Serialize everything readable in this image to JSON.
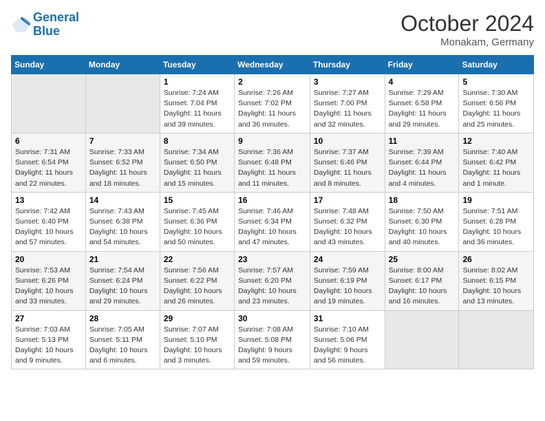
{
  "header": {
    "logo_line1": "General",
    "logo_line2": "Blue",
    "month": "October 2024",
    "location": "Monakam, Germany"
  },
  "columns": [
    "Sunday",
    "Monday",
    "Tuesday",
    "Wednesday",
    "Thursday",
    "Friday",
    "Saturday"
  ],
  "weeks": [
    [
      {
        "day": "",
        "info": ""
      },
      {
        "day": "",
        "info": ""
      },
      {
        "day": "1",
        "info": "Sunrise: 7:24 AM\nSunset: 7:04 PM\nDaylight: 11 hours and 39 minutes."
      },
      {
        "day": "2",
        "info": "Sunrise: 7:26 AM\nSunset: 7:02 PM\nDaylight: 11 hours and 36 minutes."
      },
      {
        "day": "3",
        "info": "Sunrise: 7:27 AM\nSunset: 7:00 PM\nDaylight: 11 hours and 32 minutes."
      },
      {
        "day": "4",
        "info": "Sunrise: 7:29 AM\nSunset: 6:58 PM\nDaylight: 11 hours and 29 minutes."
      },
      {
        "day": "5",
        "info": "Sunrise: 7:30 AM\nSunset: 6:56 PM\nDaylight: 11 hours and 25 minutes."
      }
    ],
    [
      {
        "day": "6",
        "info": "Sunrise: 7:31 AM\nSunset: 6:54 PM\nDaylight: 11 hours and 22 minutes."
      },
      {
        "day": "7",
        "info": "Sunrise: 7:33 AM\nSunset: 6:52 PM\nDaylight: 11 hours and 18 minutes."
      },
      {
        "day": "8",
        "info": "Sunrise: 7:34 AM\nSunset: 6:50 PM\nDaylight: 11 hours and 15 minutes."
      },
      {
        "day": "9",
        "info": "Sunrise: 7:36 AM\nSunset: 6:48 PM\nDaylight: 11 hours and 11 minutes."
      },
      {
        "day": "10",
        "info": "Sunrise: 7:37 AM\nSunset: 6:46 PM\nDaylight: 11 hours and 8 minutes."
      },
      {
        "day": "11",
        "info": "Sunrise: 7:39 AM\nSunset: 6:44 PM\nDaylight: 11 hours and 4 minutes."
      },
      {
        "day": "12",
        "info": "Sunrise: 7:40 AM\nSunset: 6:42 PM\nDaylight: 11 hours and 1 minute."
      }
    ],
    [
      {
        "day": "13",
        "info": "Sunrise: 7:42 AM\nSunset: 6:40 PM\nDaylight: 10 hours and 57 minutes."
      },
      {
        "day": "14",
        "info": "Sunrise: 7:43 AM\nSunset: 6:38 PM\nDaylight: 10 hours and 54 minutes."
      },
      {
        "day": "15",
        "info": "Sunrise: 7:45 AM\nSunset: 6:36 PM\nDaylight: 10 hours and 50 minutes."
      },
      {
        "day": "16",
        "info": "Sunrise: 7:46 AM\nSunset: 6:34 PM\nDaylight: 10 hours and 47 minutes."
      },
      {
        "day": "17",
        "info": "Sunrise: 7:48 AM\nSunset: 6:32 PM\nDaylight: 10 hours and 43 minutes."
      },
      {
        "day": "18",
        "info": "Sunrise: 7:50 AM\nSunset: 6:30 PM\nDaylight: 10 hours and 40 minutes."
      },
      {
        "day": "19",
        "info": "Sunrise: 7:51 AM\nSunset: 6:28 PM\nDaylight: 10 hours and 36 minutes."
      }
    ],
    [
      {
        "day": "20",
        "info": "Sunrise: 7:53 AM\nSunset: 6:26 PM\nDaylight: 10 hours and 33 minutes."
      },
      {
        "day": "21",
        "info": "Sunrise: 7:54 AM\nSunset: 6:24 PM\nDaylight: 10 hours and 29 minutes."
      },
      {
        "day": "22",
        "info": "Sunrise: 7:56 AM\nSunset: 6:22 PM\nDaylight: 10 hours and 26 minutes."
      },
      {
        "day": "23",
        "info": "Sunrise: 7:57 AM\nSunset: 6:20 PM\nDaylight: 10 hours and 23 minutes."
      },
      {
        "day": "24",
        "info": "Sunrise: 7:59 AM\nSunset: 6:19 PM\nDaylight: 10 hours and 19 minutes."
      },
      {
        "day": "25",
        "info": "Sunrise: 8:00 AM\nSunset: 6:17 PM\nDaylight: 10 hours and 16 minutes."
      },
      {
        "day": "26",
        "info": "Sunrise: 8:02 AM\nSunset: 6:15 PM\nDaylight: 10 hours and 13 minutes."
      }
    ],
    [
      {
        "day": "27",
        "info": "Sunrise: 7:03 AM\nSunset: 5:13 PM\nDaylight: 10 hours and 9 minutes."
      },
      {
        "day": "28",
        "info": "Sunrise: 7:05 AM\nSunset: 5:11 PM\nDaylight: 10 hours and 6 minutes."
      },
      {
        "day": "29",
        "info": "Sunrise: 7:07 AM\nSunset: 5:10 PM\nDaylight: 10 hours and 3 minutes."
      },
      {
        "day": "30",
        "info": "Sunrise: 7:08 AM\nSunset: 5:08 PM\nDaylight: 9 hours and 59 minutes."
      },
      {
        "day": "31",
        "info": "Sunrise: 7:10 AM\nSunset: 5:06 PM\nDaylight: 9 hours and 56 minutes."
      },
      {
        "day": "",
        "info": ""
      },
      {
        "day": "",
        "info": ""
      }
    ]
  ]
}
